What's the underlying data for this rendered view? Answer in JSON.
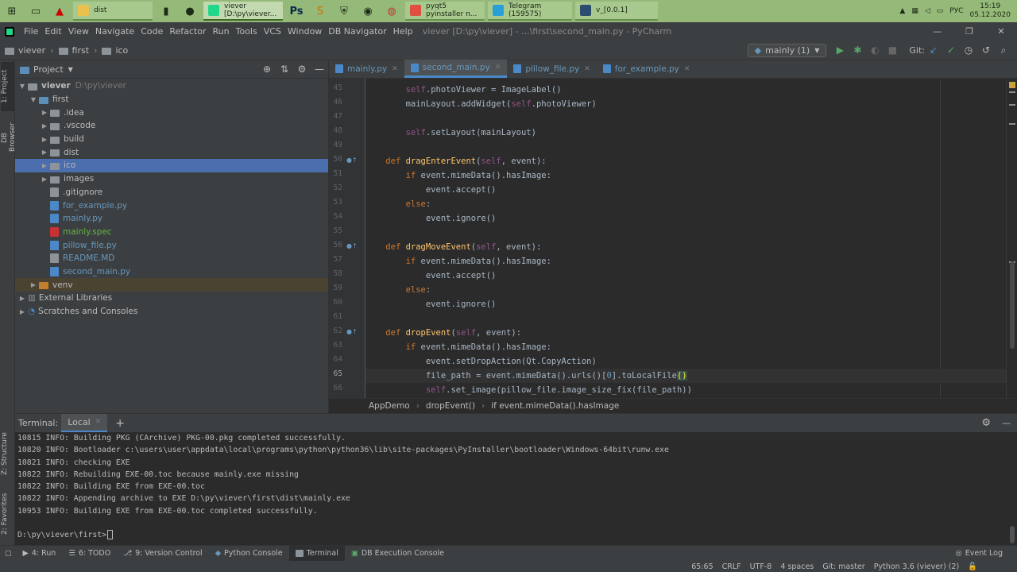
{
  "taskbar": {
    "tasks": [
      {
        "label": "dist"
      },
      {
        "label": "viever [D:\\py\\viever..."
      },
      {
        "label": "pyqt5 pyinstaller n..."
      },
      {
        "label": "Telegram (159575)"
      },
      {
        "label": "v_[0.0.1]"
      }
    ],
    "language": "РУС",
    "time": "15:19",
    "date": "05.12.2020",
    "colors": {
      "bar": "#94b978",
      "active_task": "#c2d9af"
    }
  },
  "menubar": {
    "items": [
      "File",
      "Edit",
      "View",
      "Navigate",
      "Code",
      "Refactor",
      "Run",
      "Tools",
      "VCS",
      "Window",
      "DB Navigator",
      "Help"
    ],
    "title": "viever [D:\\py\\viever] - ...\\first\\second_main.py - PyCharm"
  },
  "navbar": {
    "breadcrumbs": [
      "viever",
      "first",
      "ico"
    ],
    "run_config": "mainly (1)",
    "git_label": "Git:"
  },
  "leftstrip": {
    "tabs": [
      "1: Project",
      "DB Browser",
      "Z: Structure",
      "2: Favorites"
    ]
  },
  "project": {
    "header": "Project",
    "tree": [
      {
        "label": "viever",
        "extra": "D:\\py\\viever",
        "icon": "folder"
      },
      {
        "label": "first",
        "icon": "folder"
      },
      {
        "label": ".idea",
        "icon": "folder"
      },
      {
        "label": ".vscode",
        "icon": "folder"
      },
      {
        "label": "build",
        "icon": "folder"
      },
      {
        "label": "dist",
        "icon": "folder"
      },
      {
        "label": "ico",
        "icon": "folder",
        "selected": true
      },
      {
        "label": "images",
        "icon": "folder"
      },
      {
        "label": ".gitignore",
        "icon": "file"
      },
      {
        "label": "for_example.py",
        "icon": "py"
      },
      {
        "label": "mainly.py",
        "icon": "py"
      },
      {
        "label": "mainly.spec",
        "icon": "spec"
      },
      {
        "label": "pillow_file.py",
        "icon": "py"
      },
      {
        "label": "README.MD",
        "icon": "file"
      },
      {
        "label": "second_main.py",
        "icon": "py"
      },
      {
        "label": "venv",
        "icon": "folder"
      },
      {
        "label": "External Libraries",
        "icon": "lib"
      },
      {
        "label": "Scratches and Consoles",
        "icon": "scratch"
      }
    ]
  },
  "editor": {
    "tabs": [
      {
        "label": "mainly.py"
      },
      {
        "label": "second_main.py",
        "active": true
      },
      {
        "label": "pillow_file.py"
      },
      {
        "label": "for_example.py"
      }
    ],
    "line_numbers": [
      "45",
      "46",
      "47",
      "48",
      "49",
      "50",
      "51",
      "52",
      "53",
      "54",
      "55",
      "56",
      "57",
      "58",
      "59",
      "60",
      "61",
      "62",
      "63",
      "64",
      "65",
      "66"
    ],
    "current_line": "65",
    "breadcrumb": [
      "AppDemo",
      "dropEvent()",
      "if event.mimeData().hasImage"
    ]
  },
  "terminal": {
    "title": "Terminal:",
    "tab": "Local",
    "lines": [
      "10815 INFO: Building PKG (CArchive) PKG-00.pkg completed successfully.",
      "10820 INFO: Bootloader c:\\users\\user\\appdata\\local\\programs\\python\\python36\\lib\\site-packages\\PyInstaller\\bootloader\\Windows-64bit\\runw.exe",
      "10821 INFO: checking EXE",
      "10822 INFO: Rebuilding EXE-00.toc because mainly.exe missing",
      "10822 INFO: Building EXE from EXE-00.toc",
      "10822 INFO: Appending archive to EXE D:\\py\\viever\\first\\dist\\mainly.exe",
      "10953 INFO: Building EXE from EXE-00.toc completed successfully.",
      "",
      "D:\\py\\viever\\first>"
    ]
  },
  "toolwindows": {
    "items": [
      "4: Run",
      "6: TODO",
      "9: Version Control",
      "Python Console",
      "Terminal",
      "DB Execution Console"
    ],
    "event_log": "Event Log"
  },
  "status": {
    "position": "65:65",
    "line_sep": "CRLF",
    "encoding": "UTF-8",
    "indent": "4 spaces",
    "git": "Git: master",
    "interpreter": "Python 3.6 (viever) (2)"
  }
}
